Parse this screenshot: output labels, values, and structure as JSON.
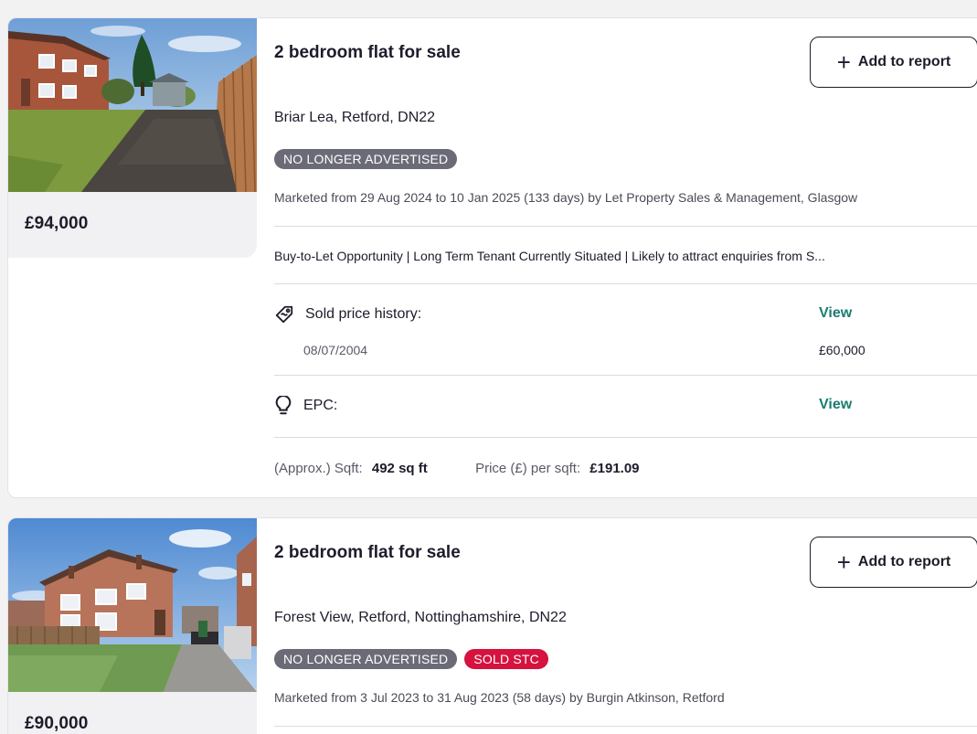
{
  "listings": [
    {
      "title": "2 bedroom flat for sale",
      "add_to_report_label": "Add to report",
      "address": "Briar Lea, Retford, DN22",
      "badges": [
        "NO LONGER ADVERTISED"
      ],
      "marketed": "Marketed from 29 Aug 2024 to 10 Jan 2025 (133 days) by Let Property Sales & Management, Glasgow",
      "summary": "Buy-to-Let Opportunity | Long Term Tenant Currently Situated | Likely to attract enquiries from S...",
      "price": "£94,000",
      "sold_price_history": {
        "label": "Sold price history:",
        "view_label": "View",
        "entries": [
          {
            "date": "08/07/2004",
            "price": "£60,000"
          }
        ]
      },
      "epc": {
        "label": "EPC:",
        "view_label": "View"
      },
      "sqft": {
        "label": "(Approx.) Sqft:",
        "value": "492 sq ft",
        "price_per_sqft_label": "Price (£) per sqft:",
        "price_per_sqft_value": "£191.09"
      }
    },
    {
      "title": "2 bedroom flat for sale",
      "add_to_report_label": "Add to report",
      "address": "Forest View, Retford, Nottinghamshire, DN22",
      "badges": [
        "NO LONGER ADVERTISED",
        "SOLD STC"
      ],
      "marketed": "Marketed from 3 Jul 2023 to 31 Aug 2023 (58 days) by Burgin Atkinson, Retford",
      "price": "£90,000"
    }
  ],
  "icons": {
    "add": "plus-icon",
    "sold_price_history": "price-tag-icon",
    "epc": "lightbulb-icon"
  },
  "colors": {
    "view_link": "#1a7d6f",
    "badge_grey": "#6b6b78",
    "badge_red": "#d6123f",
    "text_primary": "#1c1c2b"
  }
}
